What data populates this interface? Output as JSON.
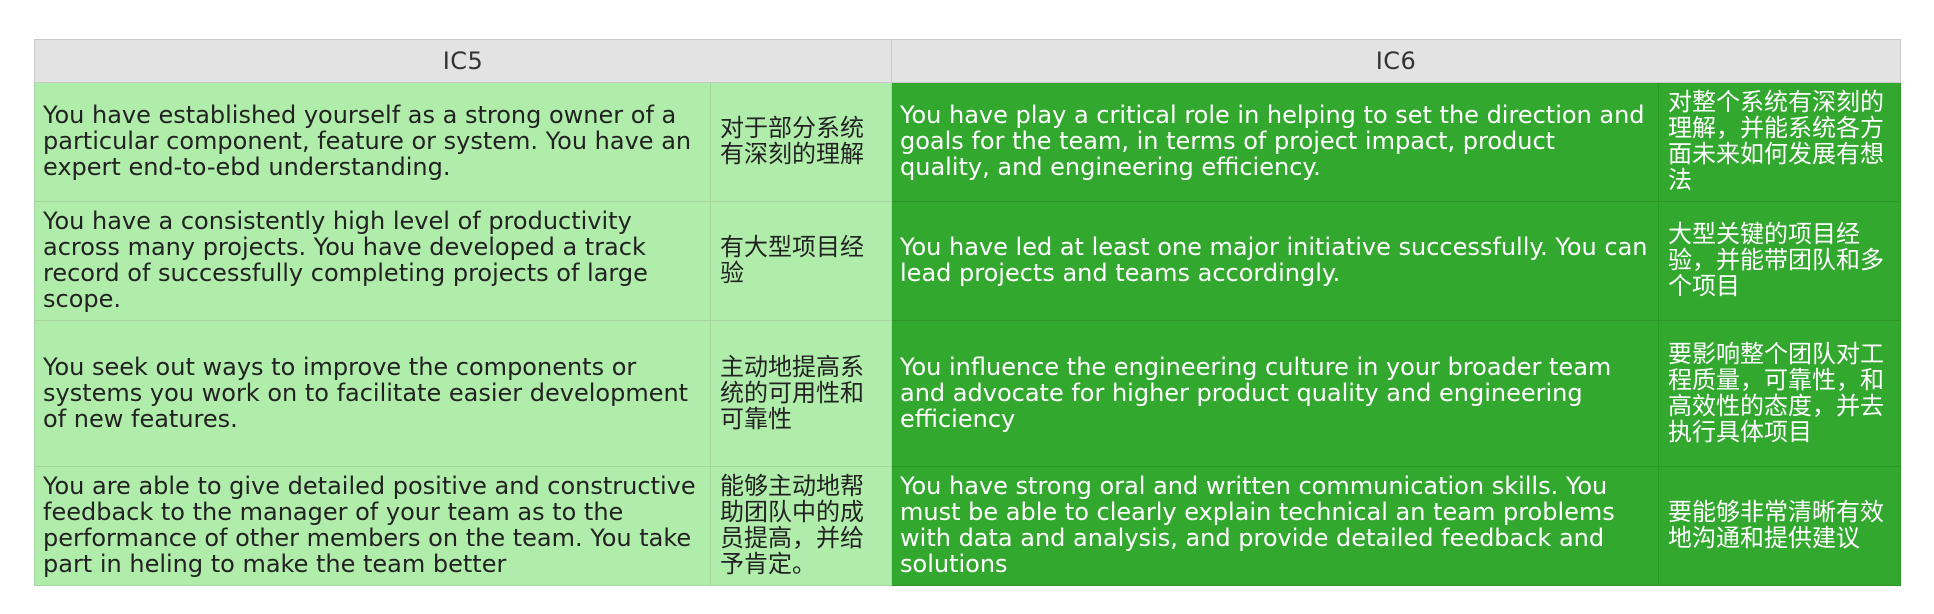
{
  "table": {
    "headers": [
      "IC5",
      "IC6"
    ],
    "rows": [
      {
        "ic5_en": "You have established yourself as a strong owner of a particular component, feature or system. You have an expert end-to-ebd understanding.",
        "ic5_cn": "对于部分系统有深刻的理解",
        "ic6_en": "You have play a critical role in helping to set the direction and goals for the team, in terms of project impact, product quality, and engineering efficiency.",
        "ic6_cn": "对整个系统有深刻的理解，并能系统各方面未来如何发展有想法"
      },
      {
        "ic5_en": "You have a consistently high level of productivity across many projects. You have developed a track record of successfully completing projects of large scope.",
        "ic5_cn": "有大型项目经验",
        "ic6_en": "You have led at least one major initiative successfully. You can lead projects and teams accordingly.",
        "ic6_cn": "大型关键的项目经验，并能带团队和多个项目"
      },
      {
        "ic5_en": "You seek out ways to improve the components or systems you work on to facilitate easier development of new features.",
        "ic5_cn": "主动地提高系统的可用性和可靠性",
        "ic6_en": "You influence the engineering culture in your broader team and advocate for higher product quality and engineering efficiency",
        "ic6_cn": "要影响整个团队对工程质量，可靠性，和高效性的态度，并去执行具体项目"
      },
      {
        "ic5_en": "You are able to give detailed positive and constructive feedback to the manager of your team as to the performance of other members on the team. You take part in heling to make the team better",
        "ic5_cn": "能够主动地帮助团队中的成员提高，并给予肯定。",
        "ic6_en": "You have strong oral and written communication skills. You must be able to clearly explain technical an team problems with data and analysis, and provide detailed feedback and solutions",
        "ic6_cn": "要能够非常清晰有效地沟通和提供建议"
      }
    ]
  }
}
